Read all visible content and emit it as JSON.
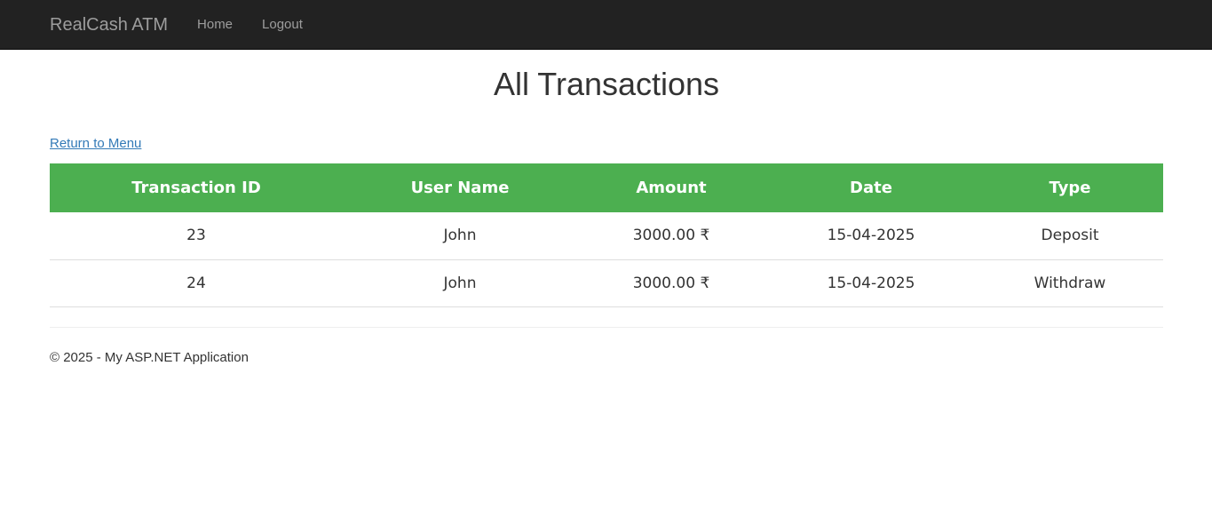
{
  "navbar": {
    "brand": "RealCash ATM",
    "links": [
      {
        "label": "Home"
      },
      {
        "label": "Logout"
      }
    ],
    "background": "#222222"
  },
  "page": {
    "title": "All Transactions",
    "return_link": "Return to Menu"
  },
  "table": {
    "header_color": "#4caf50",
    "columns": [
      "Transaction ID",
      "User Name",
      "Amount",
      "Date",
      "Type"
    ],
    "rows": [
      {
        "id": "23",
        "user": "John",
        "amount": "3000.00 ₹",
        "date": "15-04-2025",
        "type": "Deposit"
      },
      {
        "id": "24",
        "user": "John",
        "amount": "3000.00 ₹",
        "date": "15-04-2025",
        "type": "Withdraw"
      }
    ]
  },
  "footer": {
    "text": "© 2025 - My ASP.NET Application"
  }
}
